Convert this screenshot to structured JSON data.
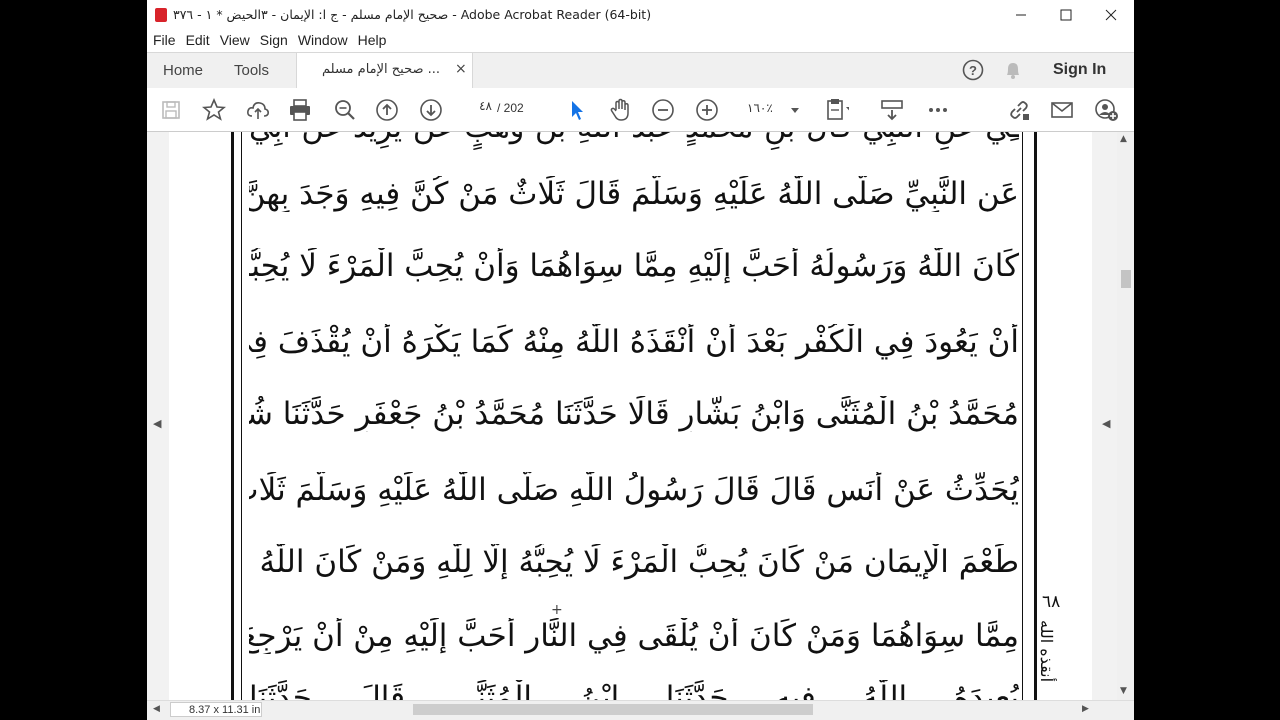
{
  "window": {
    "title": "صحيح الإمام مسلم - ج ا: الإيمان - ٣الحيض * ١ - ٣٧٦ - Adobe Acrobat Reader (64-bit)",
    "minimize_icon": "minimize-icon",
    "maximize_icon": "maximize-icon",
    "close_icon": "close-icon"
  },
  "menu": [
    "File",
    "Edit",
    "View",
    "Sign",
    "Window",
    "Help"
  ],
  "tabs": {
    "home": "Home",
    "tools": "Tools",
    "document": "صحيح الإمام مسلم ...",
    "close": "×",
    "sign_in": "Sign In"
  },
  "toolbar": {
    "page_current": "٤٨",
    "page_total": "/  202",
    "zoom": "١٦٠٪"
  },
  "document": {
    "lines": [
      "عَنِ النَّبِيِّ صَلَّى اللّٰهُ عَلَيْهِ وَسَلَّمَ قَالَ ثَلَاثٌ مَنْ كُنَّ فِيهِ وَجَدَ بِهِنَّ حَلَاوَةَ الْإِيمَانِ مَنْ",
      "كَانَ اللّٰهُ وَرَسُولُهُ أَحَبَّ إِلَيْهِ مِمَّا سِوَاهُمَا وَأَنْ يُحِبَّ الْمَرْءَ لَا يُحِبُّهُ إِلَّا لِلّٰهِ وَأَنْ يَكْرَهَ",
      "أَنْ يَعُودَ فِي الْكُفْرِ بَعْدَ أَنْ أَنْقَذَهُ اللّٰهُ مِنْهُ كَمَا يَكْرَهُ أَنْ يُقْذَفَ فِي النَّارِ حدثنا",
      "مُحَمَّدُ بْنُ الْمُثَنَّى وَابْنُ بَشَّارٍ قَالَا حَدَّثَنَا مُحَمَّدُ بْنُ جَعْفَرٍ حَدَّثَنَا شُعْبَةُ قَالَ سَمِعْتُ قَتَادَةَ",
      "يُحَدِّثُ عَنْ أَنَسٍ قَالَ قَالَ رَسُولُ اللّٰهِ صَلَّى اللّٰهُ عَلَيْهِ وَسَلَّمَ ثَلَاثٌ مَنْ كُنَّ فِيهِ وَجَدَ",
      "طَعْمَ الْإِيمَانِ مَنْ كَانَ يُحِبُّ الْمَرْءَ لَا يُحِبُّهُ إِلَّا لِلّٰهِ وَمَنْ كَانَ اللّٰهُ وَرَسُولُهُ أَحَبَّ إِلَيْهِ",
      "مِمَّا سِوَاهُمَا وَمَنْ كَانَ أَنْ يُلْقَى فِي النَّارِ أَحَبَّ إِلَيْهِ مِنْ أَنْ يَرْجِعَ فِي الْكُفْرِ بَعْدَ أَنْ"
    ],
    "margin_number": "٦٨",
    "margin_note": "أنقذه الله"
  },
  "status": {
    "page_size": "8.37 x 11.31 in"
  }
}
